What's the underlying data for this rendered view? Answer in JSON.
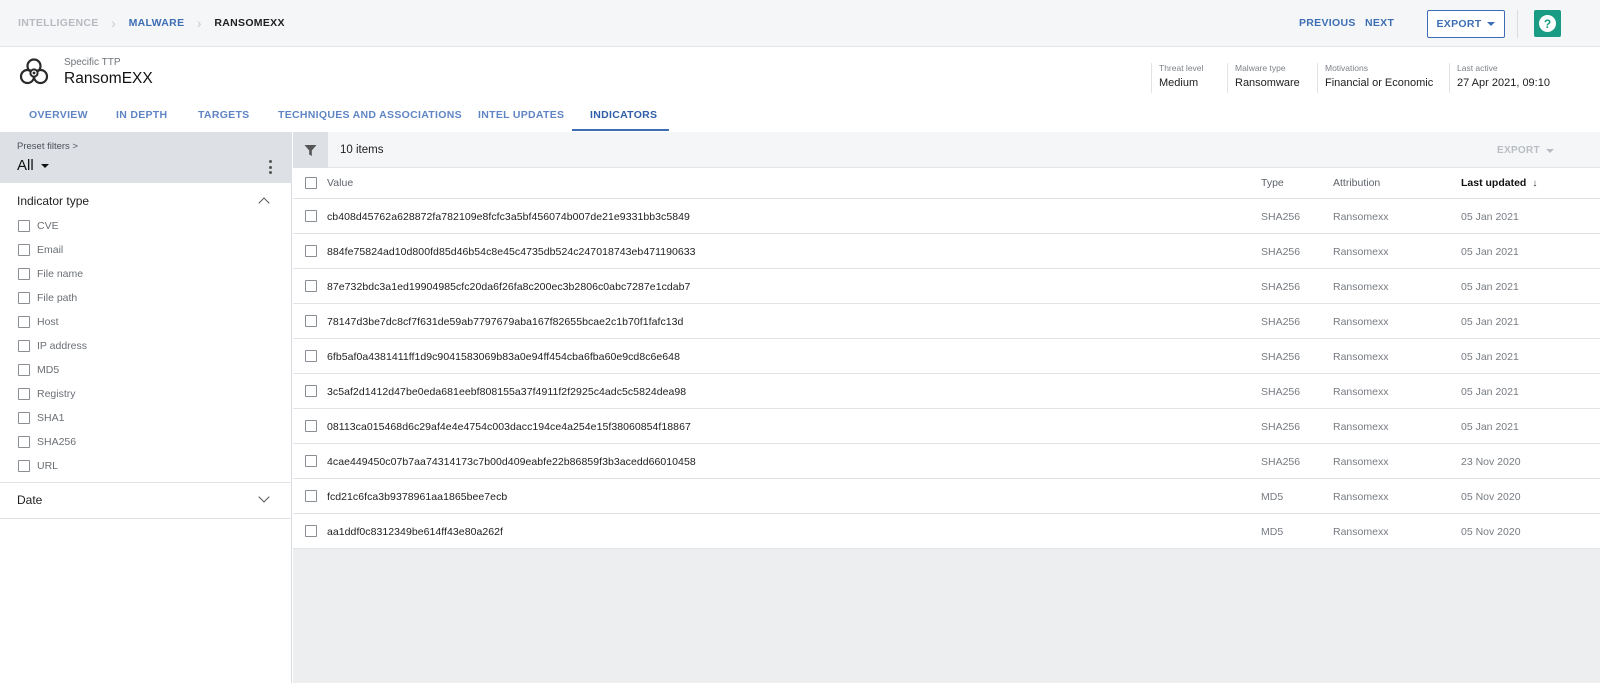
{
  "breadcrumb": {
    "items": [
      "INTELLIGENCE",
      "MALWARE",
      "RANSOMEXX"
    ]
  },
  "nav": {
    "previous": "PREVIOUS",
    "next": "NEXT",
    "export": "EXPORT",
    "help": "?"
  },
  "header": {
    "subtitle": "Specific TTP",
    "title": "RansomEXX",
    "meta": [
      {
        "label": "Threat level",
        "value": "Medium"
      },
      {
        "label": "Malware type",
        "value": "Ransomware"
      },
      {
        "label": "Motivations",
        "value": "Financial or Economic"
      },
      {
        "label": "Last active",
        "value": "27 Apr 2021, 09:10"
      }
    ]
  },
  "tabs": [
    "OVERVIEW",
    "IN DEPTH",
    "TARGETS",
    "TECHNIQUES AND ASSOCIATIONS",
    "INTEL UPDATES",
    "INDICATORS"
  ],
  "active_tab": "INDICATORS",
  "sidebar": {
    "preset_label": "Preset filters >",
    "preset_value": "All",
    "indicator_type_title": "Indicator type",
    "indicator_types": [
      "CVE",
      "Email",
      "File name",
      "File path",
      "Host",
      "IP address",
      "MD5",
      "Registry",
      "SHA1",
      "SHA256",
      "URL"
    ],
    "date_title": "Date"
  },
  "toolbar": {
    "count": "10 items",
    "export": "EXPORT"
  },
  "table": {
    "columns": {
      "value": "Value",
      "type": "Type",
      "attribution": "Attribution",
      "last_updated": "Last updated"
    },
    "sort_indicator": "↓",
    "rows": [
      {
        "value": "cb408d45762a628872fa782109e8fcfc3a5bf456074b007de21e9331bb3c5849",
        "type": "SHA256",
        "attribution": "Ransomexx",
        "date": "05 Jan 2021"
      },
      {
        "value": "884fe75824ad10d800fd85d46b54c8e45c4735db524c247018743eb471190633",
        "type": "SHA256",
        "attribution": "Ransomexx",
        "date": "05 Jan 2021"
      },
      {
        "value": "87e732bdc3a1ed19904985cfc20da6f26fa8c200ec3b2806c0abc7287e1cdab7",
        "type": "SHA256",
        "attribution": "Ransomexx",
        "date": "05 Jan 2021"
      },
      {
        "value": "78147d3be7dc8cf7f631de59ab7797679aba167f82655bcae2c1b70f1fafc13d",
        "type": "SHA256",
        "attribution": "Ransomexx",
        "date": "05 Jan 2021"
      },
      {
        "value": "6fb5af0a4381411ff1d9c9041583069b83a0e94ff454cba6fba60e9cd8c6e648",
        "type": "SHA256",
        "attribution": "Ransomexx",
        "date": "05 Jan 2021"
      },
      {
        "value": "3c5af2d1412d47be0eda681eebf808155a37f4911f2f2925c4adc5c5824dea98",
        "type": "SHA256",
        "attribution": "Ransomexx",
        "date": "05 Jan 2021"
      },
      {
        "value": "08113ca015468d6c29af4e4e4754c003dacc194ce4a254e15f38060854f18867",
        "type": "SHA256",
        "attribution": "Ransomexx",
        "date": "05 Jan 2021"
      },
      {
        "value": "4cae449450c07b7aa74314173c7b00d409eabfe22b86859f3b3acedd66010458",
        "type": "SHA256",
        "attribution": "Ransomexx",
        "date": "23 Nov 2020"
      },
      {
        "value": "fcd21c6fca3b9378961aa1865bee7ecb",
        "type": "MD5",
        "attribution": "Ransomexx",
        "date": "05 Nov 2020"
      },
      {
        "value": "aa1ddf0c8312349be614ff43e80a262f",
        "type": "MD5",
        "attribution": "Ransomexx",
        "date": "05 Nov 2020"
      }
    ]
  },
  "icons": {
    "logo": "biohazard-icon",
    "filter": "funnel-icon",
    "more": "kebab-icon"
  },
  "colors": {
    "accent": "#3d6eb5",
    "help": "#1a9c84"
  }
}
